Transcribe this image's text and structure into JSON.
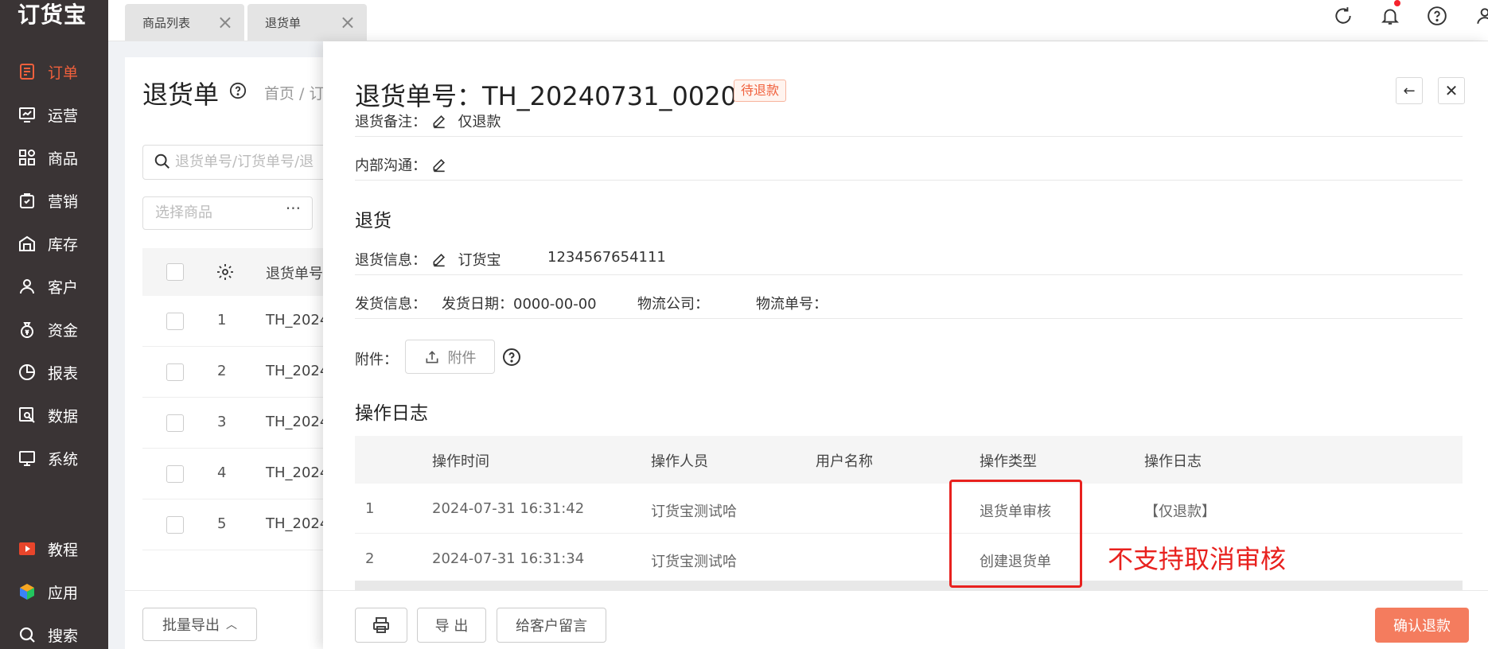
{
  "app": {
    "logo": "订货宝"
  },
  "sidebar": {
    "items": [
      {
        "label": "订单",
        "icon": "order-icon",
        "active": true
      },
      {
        "label": "运营",
        "icon": "operation-chart-icon"
      },
      {
        "label": "商品",
        "icon": "goods-grid-icon"
      },
      {
        "label": "营销",
        "icon": "marketing-bag-icon"
      },
      {
        "label": "库存",
        "icon": "warehouse-icon"
      },
      {
        "label": "客户",
        "icon": "customer-icon"
      },
      {
        "label": "资金",
        "icon": "money-bag-icon"
      },
      {
        "label": "报表",
        "icon": "pie-chart-icon"
      },
      {
        "label": "数据",
        "icon": "data-search-icon"
      },
      {
        "label": "系统",
        "icon": "monitor-icon"
      }
    ],
    "bottom_items": [
      {
        "label": "教程",
        "icon": "video-play-icon"
      },
      {
        "label": "应用",
        "icon": "cube-icon"
      },
      {
        "label": "搜索",
        "icon": "search-icon"
      }
    ],
    "active_color": "#f0603c"
  },
  "tabs": [
    {
      "label": "商品列表"
    },
    {
      "label": "退货单"
    }
  ],
  "page": {
    "title": "退货单",
    "breadcrumb": "首页 / 订",
    "search_placeholder": "退货单号/订货单号/退",
    "select_placeholder": "选择商品",
    "select_more": "···",
    "column_label": "退货单号",
    "rows": [
      {
        "num": "1",
        "code": "TH_2024"
      },
      {
        "num": "2",
        "code": "TH_2024"
      },
      {
        "num": "3",
        "code": "TH_2024"
      },
      {
        "num": "4",
        "code": "TH_2024"
      },
      {
        "num": "5",
        "code": "TH_2024"
      }
    ],
    "batch_export": "批量导出"
  },
  "drawer": {
    "title_prefix": "退货单号：",
    "order_no": "TH_20240731_0020",
    "status": "待退款",
    "back_icon": "←",
    "close_icon": "✕",
    "remark_label": "退货备注：",
    "remark_value": "仅退款",
    "internal_label": "内部沟通：",
    "return_section": "退货",
    "return_info_label": "退货信息：",
    "return_info_name": "订货宝",
    "return_info_phone": "1234567654111",
    "ship_info_label": "发货信息：",
    "ship_date": "发货日期：0000-00-00",
    "ship_company": "物流公司：",
    "ship_no": "物流单号：",
    "attach_label": "附件：",
    "attach_button": "附件",
    "log_section": "操作日志",
    "log_columns": [
      "操作时间",
      "操作人员",
      "用户名称",
      "操作类型",
      "操作日志"
    ],
    "log_rows": [
      {
        "idx": "1",
        "time": "2024-07-31 16:31:42",
        "operator": "订货宝测试哈",
        "user": "",
        "type": "退货单审核",
        "log": "【仅退款】"
      },
      {
        "idx": "2",
        "time": "2024-07-31 16:31:34",
        "operator": "订货宝测试哈",
        "user": "",
        "type": "创建退货单",
        "log": ""
      }
    ],
    "annotation": "不支持取消审核",
    "annotation_color": "#e8211e",
    "footer": {
      "print_icon": "printer-icon",
      "export": "导 出",
      "message": "给客户留言",
      "confirm": "确认退款"
    }
  }
}
